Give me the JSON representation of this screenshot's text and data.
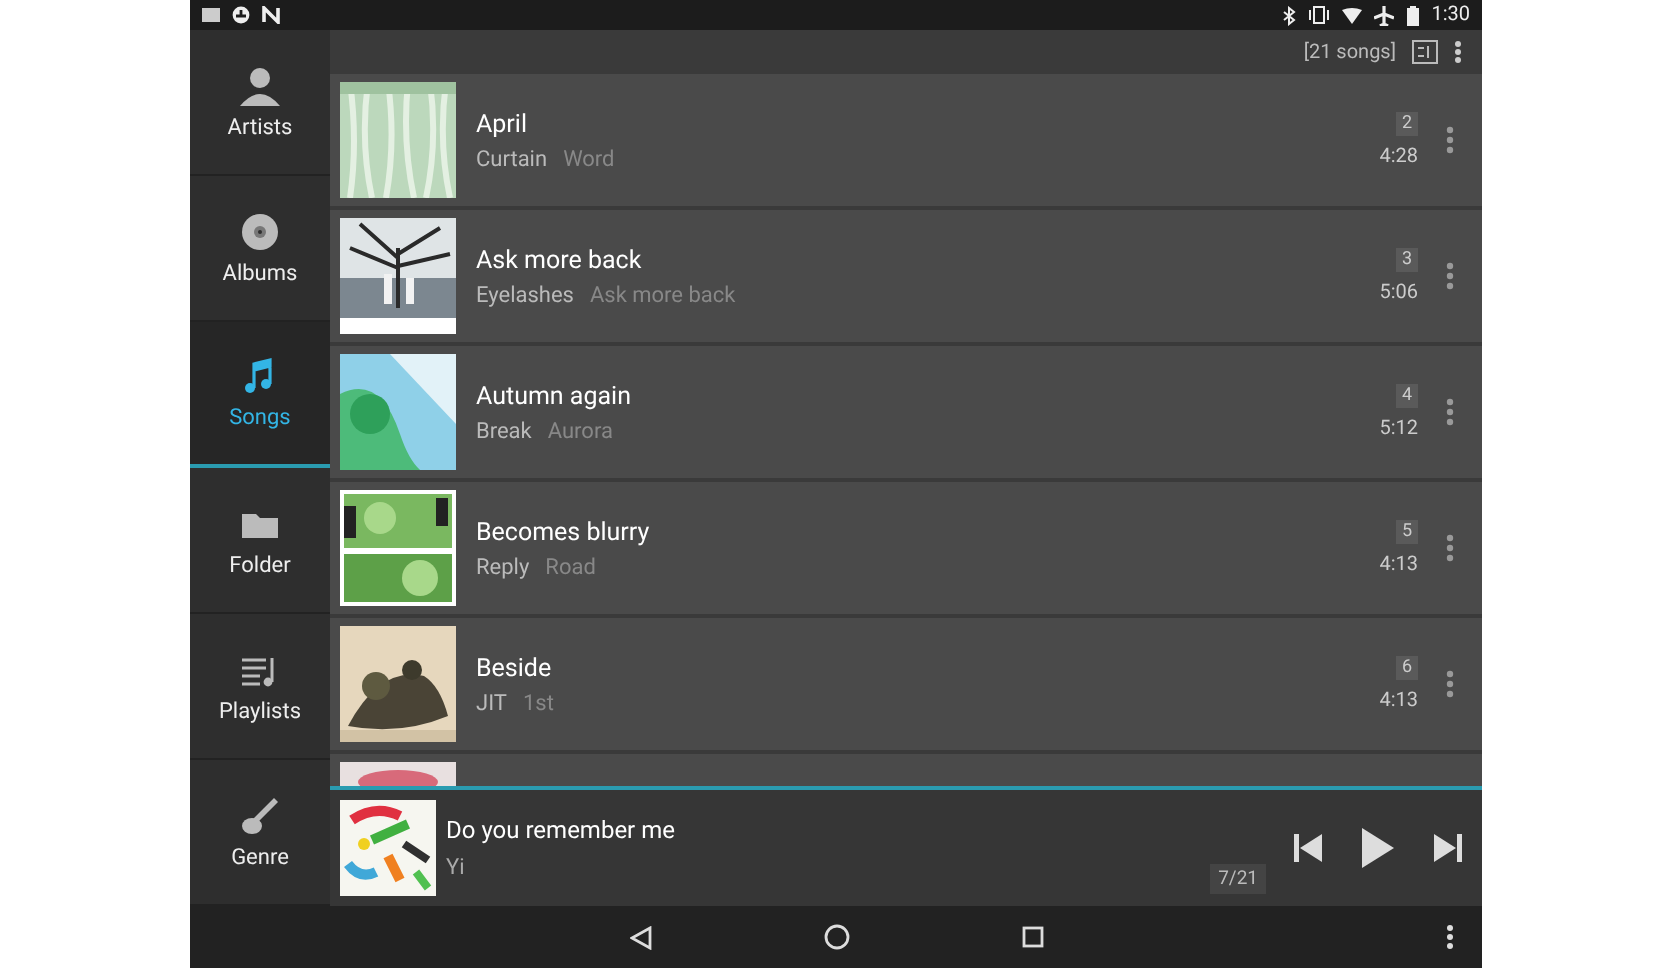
{
  "status_bar": {
    "time": "1:30"
  },
  "toolbar": {
    "count": "[21 songs]"
  },
  "sidebar": {
    "items": [
      {
        "label": "Artists",
        "selected": false
      },
      {
        "label": "Albums",
        "selected": false
      },
      {
        "label": "Songs",
        "selected": true
      },
      {
        "label": "Folder",
        "selected": false
      },
      {
        "label": "Playlists",
        "selected": false
      },
      {
        "label": "Genre",
        "selected": false
      }
    ]
  },
  "songs": [
    {
      "kind": "song",
      "title": "April",
      "artist": "Curtain",
      "album": "Word",
      "track": "2",
      "duration": "4:28"
    },
    {
      "kind": "song",
      "title": "Ask more back",
      "artist": "Eyelashes",
      "album": "Ask more back",
      "track": "3",
      "duration": "5:06"
    },
    {
      "kind": "song",
      "title": "Autumn again",
      "artist": "Break",
      "album": "Aurora",
      "track": "4",
      "duration": "5:12"
    },
    {
      "kind": "song",
      "title": "Becomes blurry",
      "artist": "Reply",
      "album": "Road",
      "track": "5",
      "duration": "4:13"
    },
    {
      "kind": "song",
      "title": "Beside",
      "artist": "JIT",
      "album": "1st",
      "track": "6",
      "duration": "4:13"
    },
    {
      "kind": "partial"
    }
  ],
  "now_playing": {
    "title": "Do you remember me",
    "artist": "Yi",
    "position": "7/21"
  }
}
